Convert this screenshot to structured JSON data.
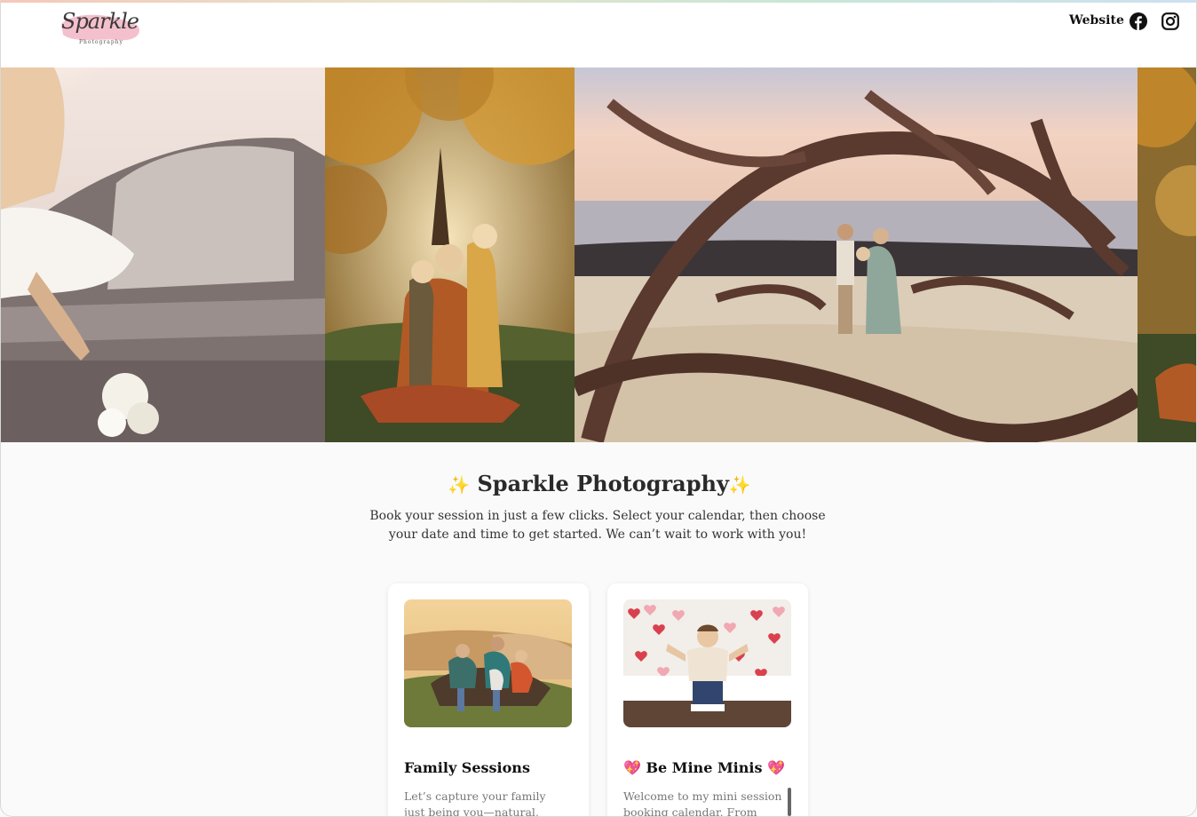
{
  "header": {
    "logo": {
      "word": "Sparkle",
      "sub": "Photography"
    },
    "nav_website": "Website",
    "icons": [
      "facebook-icon",
      "instagram-icon"
    ]
  },
  "hero": {
    "images": [
      "woman-in-vintage-car-photo",
      "mother-with-children-autumn-photo",
      "family-on-beach-driftwood-photo",
      "autumn-family-photo-partial"
    ]
  },
  "intro": {
    "sparkle_left": "✨",
    "title": "Sparkle Photography",
    "sparkle_right": "✨",
    "description": "Book your session in just a few clicks. Select your calendar, then choose your date and time to get started. We can’t wait to work with you!"
  },
  "cards": [
    {
      "title": "Family Sessions",
      "description": "Let’s capture your family just being you—natural, relaxed, and",
      "image": "family-on-rocks-photo"
    },
    {
      "title": "💖 Be Mine Minis 💖",
      "description": "Welcome to my mini session booking calendar. From giggles",
      "image": "boy-with-heart-backdrop-photo"
    }
  ],
  "colors": {
    "accent_gold": "#f2c23e",
    "logo_pink": "#f3b9c8",
    "text_dark": "#2a2a2a"
  }
}
